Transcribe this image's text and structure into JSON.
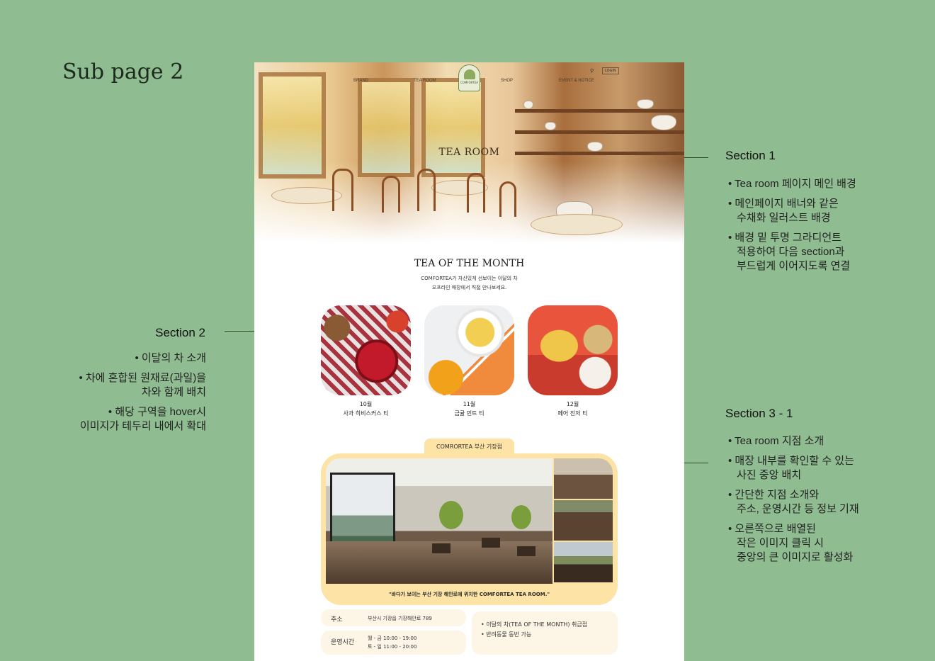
{
  "page_label": "Sub page 2",
  "annotations": {
    "section1": {
      "title": "Section 1",
      "items": [
        "• Tea room 페이지 메인 배경",
        "• 메인페이지 배너와 같은\n수채화 일러스트 배경",
        "• 배경 밑 투명 그라디언트\n적용하여 다음 section과\n부드럽게 이어지도록 연결"
      ]
    },
    "section2": {
      "title": "Section 2",
      "items": [
        "• 이달의 차 소개",
        "• 차에 혼합된 원재료(과일)을\n차와 함께 배치",
        "• 해당 구역을 hover시\n이미지가 테두리 내에서 확대"
      ]
    },
    "section3": {
      "title": "Section 3 - 1",
      "items": [
        "• Tea room 지점 소개",
        "• 매장 내부를 확인할 수 있는\n사진 중앙 배치",
        "• 간단한 지점 소개와\n주소, 운영시간 등 정보 기재",
        "• 오른쪽으로 배열된\n작은 이미지 클릭 시\n중앙의 큰 이미지로 활성화"
      ]
    }
  },
  "nav": {
    "brand": "BRAND",
    "tea_room": "TEA ROOM",
    "shop": "SHOP",
    "event": "EVENT & NOTICE",
    "logo_text": "COMFORTEA",
    "login": "LOGIN"
  },
  "hero": {
    "title": "TEA ROOM"
  },
  "tea_of_month": {
    "title": "TEA OF THE MONTH",
    "desc_line1": "COMFORTEA가 자신있게 선보이는 이달의 차",
    "desc_line2": "오프라인 매장에서 직접 만나보세요.",
    "items": [
      {
        "month": "10월",
        "name": "사과 히비스커스 티"
      },
      {
        "month": "11월",
        "name": "금귤 민트 티"
      },
      {
        "month": "12월",
        "name": "페어 진저 티"
      }
    ]
  },
  "branch": {
    "tab": "COMRORTEA 부산 기장점",
    "caption": "\"바다가 보이는 부산 기장 해안로에 위치한 COMFORTEA TEA ROOM.\"",
    "address_label": "주소",
    "address_value": "부산시 기장읍 기장해안로 789",
    "hours_label": "운영시간",
    "hours_weekday": "월 - 금 10:00 - 19:00",
    "hours_weekend": "토 - 일 11:00 - 20:00",
    "note1": "• 이달의 차(TEA OF THE MONTH) 취급점",
    "note2": "• 반려동물 동반 가능"
  },
  "colors": {
    "background": "#8fbc90",
    "accent": "#fde3a6",
    "info_bg": "#fdf5e6"
  }
}
